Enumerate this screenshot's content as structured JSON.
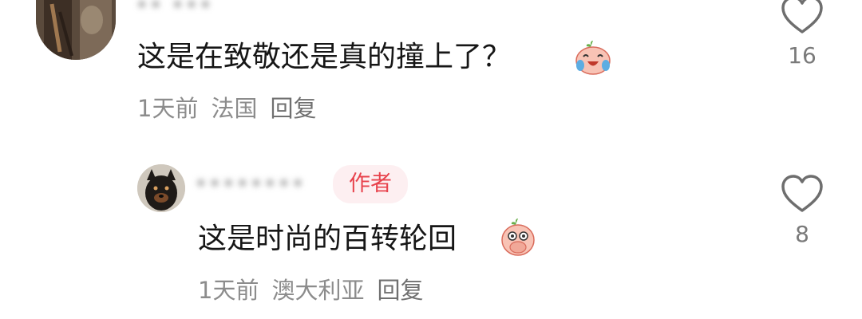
{
  "comments": [
    {
      "username": "•• •••",
      "text": "这是在致敬还是真的撞上了？",
      "emoji": "crying-laughing-peach-emoji",
      "meta": {
        "time": "1天前",
        "location": "法国",
        "reply": "回复"
      },
      "likes": {
        "icon": "heart-outline-icon",
        "count": "16"
      }
    },
    {
      "username": "••••••••",
      "badge": "作者",
      "text": "这是时尚的百转轮回",
      "emoji": "covering-mouth-peach-emoji",
      "meta": {
        "time": "1天前",
        "location": "澳大利亚",
        "reply": "回复"
      },
      "likes": {
        "icon": "heart-outline-icon",
        "count": "8"
      }
    }
  ],
  "colors": {
    "text": "#161616",
    "meta": "#8c8c8c",
    "badge_text": "#e8434d",
    "badge_bg": "#fdeff1"
  }
}
